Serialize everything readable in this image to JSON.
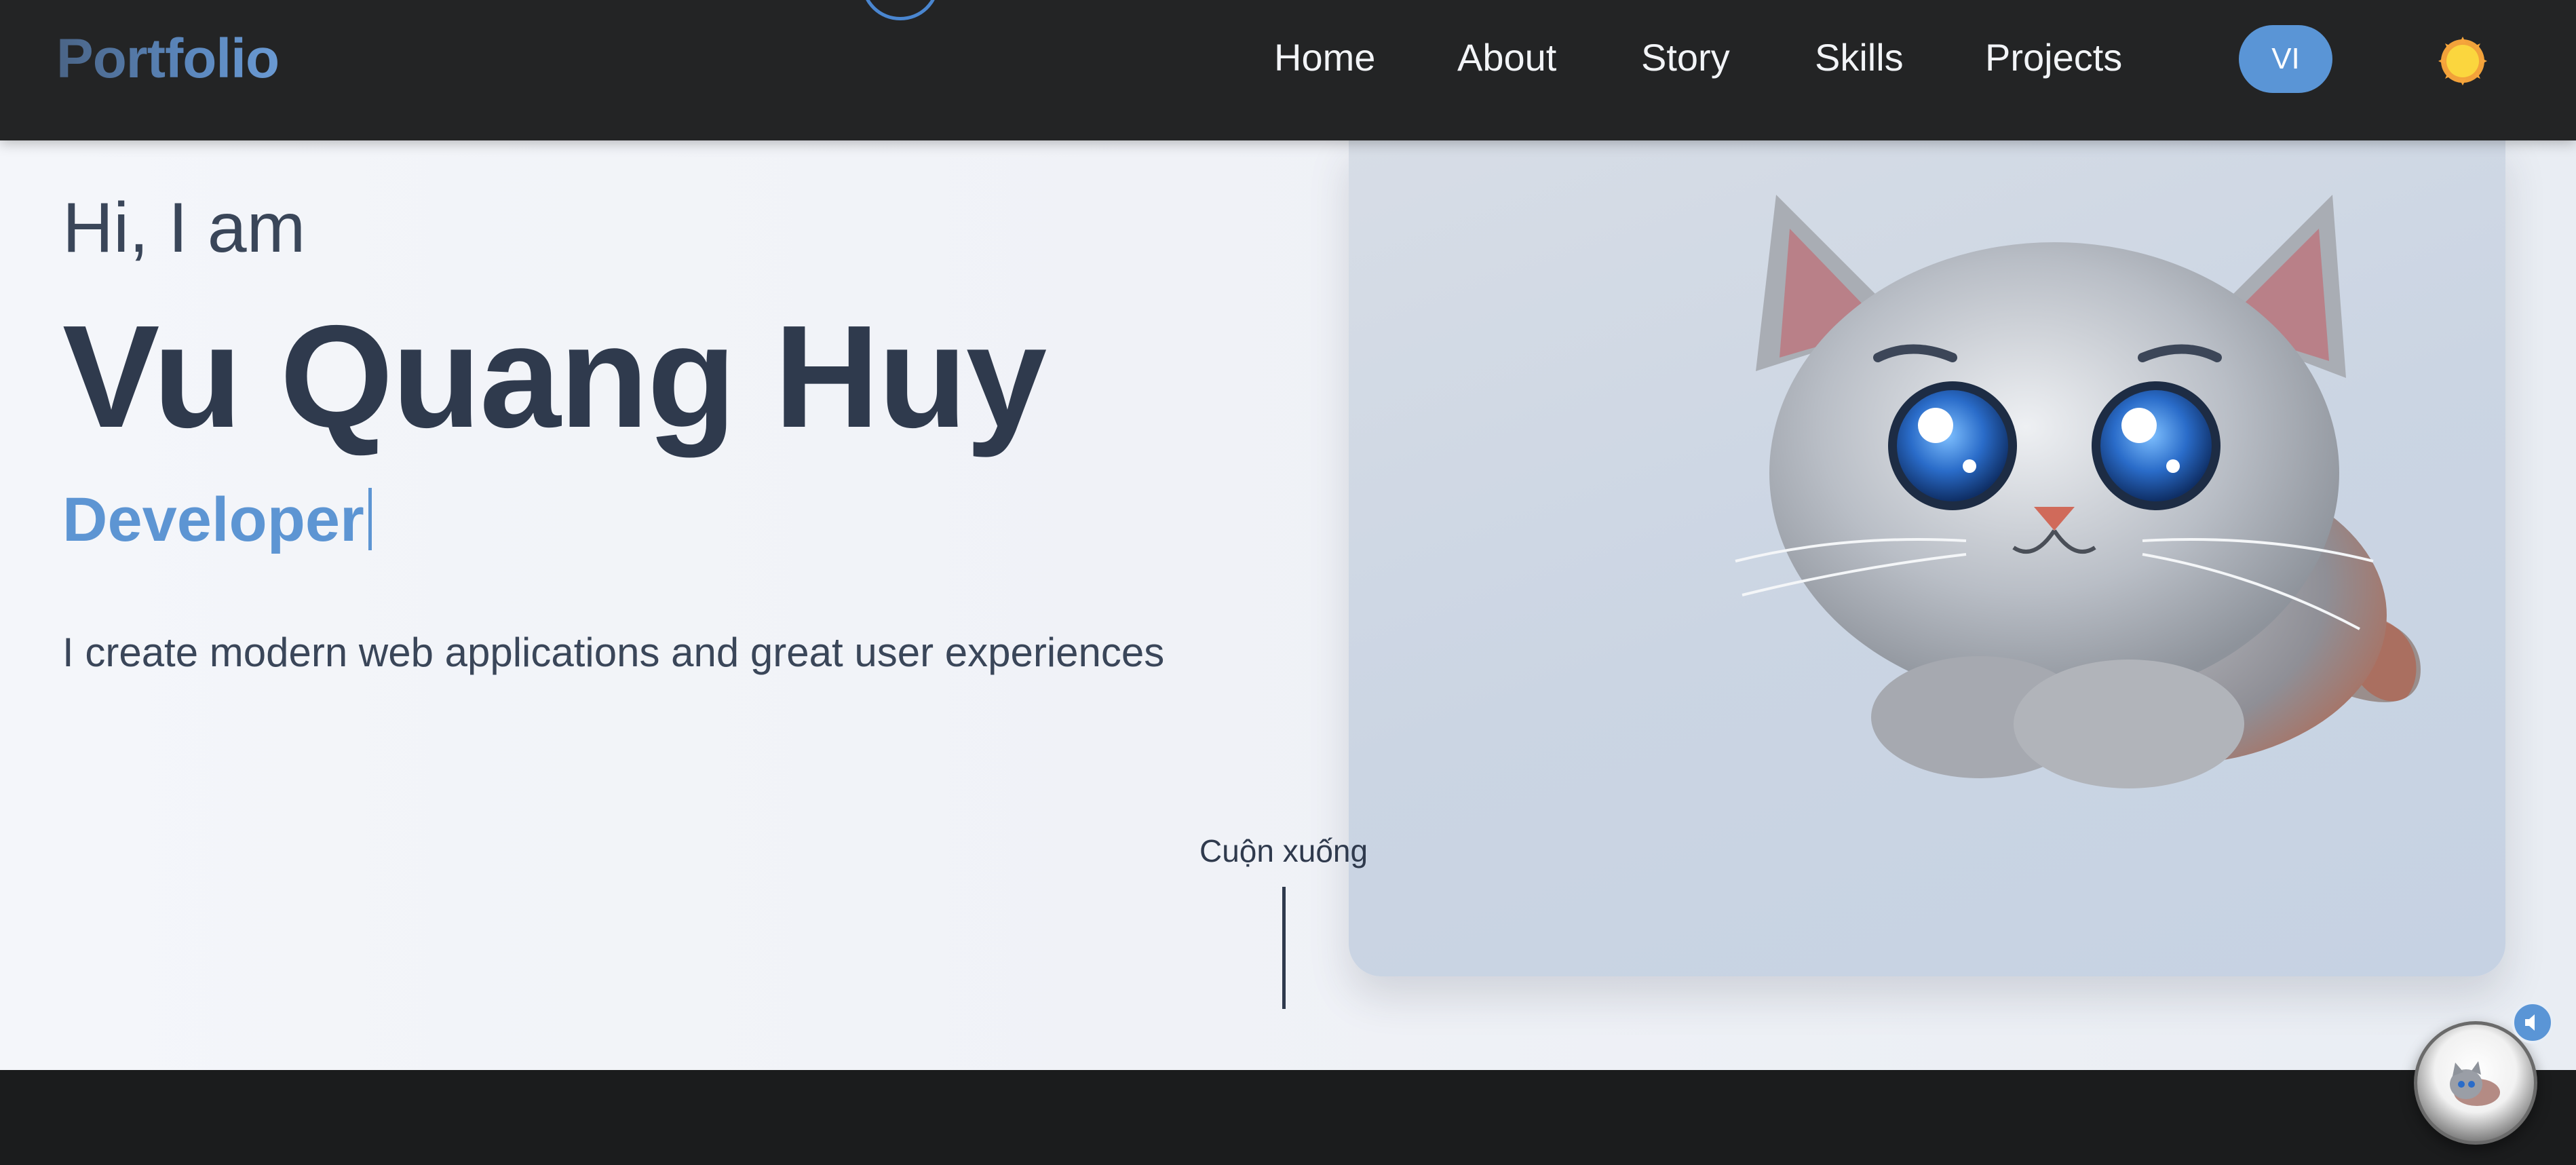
{
  "header": {
    "brand": "Portfolio",
    "nav": [
      {
        "label": "Home"
      },
      {
        "label": "About"
      },
      {
        "label": "Story"
      },
      {
        "label": "Skills"
      },
      {
        "label": "Projects"
      }
    ],
    "language_button": "VI",
    "theme_icon": "sun-icon"
  },
  "hero": {
    "greeting": "Hi, I am",
    "name": "Vu Quang Huy",
    "role": "Developer",
    "tagline": "I create modern web applications and great user experiences",
    "scroll_label": "Cuộn xuống",
    "image": "cat-illustration"
  },
  "widgets": {
    "chat_icon": "cat-avatar-icon",
    "badge_icon": "speaker-icon"
  },
  "colors": {
    "accent": "#5d95d3",
    "nav_bg": "#232425",
    "heading": "#2f3a4d",
    "footer_bg": "#1b1c1d"
  }
}
